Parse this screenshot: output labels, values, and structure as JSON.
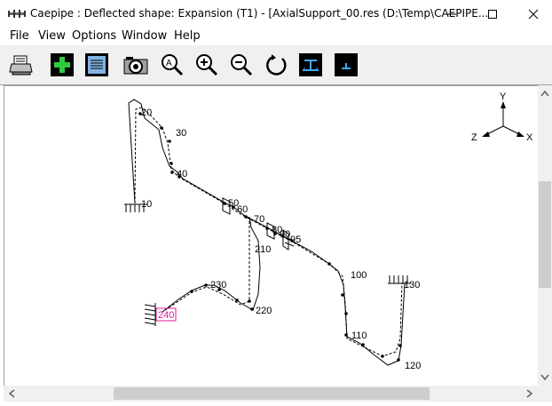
{
  "window": {
    "title": "Caepipe : Deflected shape: Expansion (T1) -  [AxialSupport_00.res (D:\\Temp\\CAEPIPE..."
  },
  "menu": [
    "File",
    "View",
    "Options",
    "Window",
    "Help"
  ],
  "toolbar": {
    "buttons": [
      "print-icon",
      "add-icon",
      "list-icon",
      "camera-icon",
      "zoom-all-icon",
      "zoom-in-icon",
      "zoom-out-icon",
      "rotate-icon",
      "support-icon",
      "anchor-icon"
    ]
  },
  "axes": {
    "y": "Y",
    "z": "Z",
    "x": "X"
  },
  "nodes": [
    "20",
    "30",
    "40",
    "10",
    "50",
    "60",
    "70",
    "80",
    "90",
    "95",
    "210",
    "100",
    "130",
    "230",
    "220",
    "240",
    "110",
    "120"
  ]
}
